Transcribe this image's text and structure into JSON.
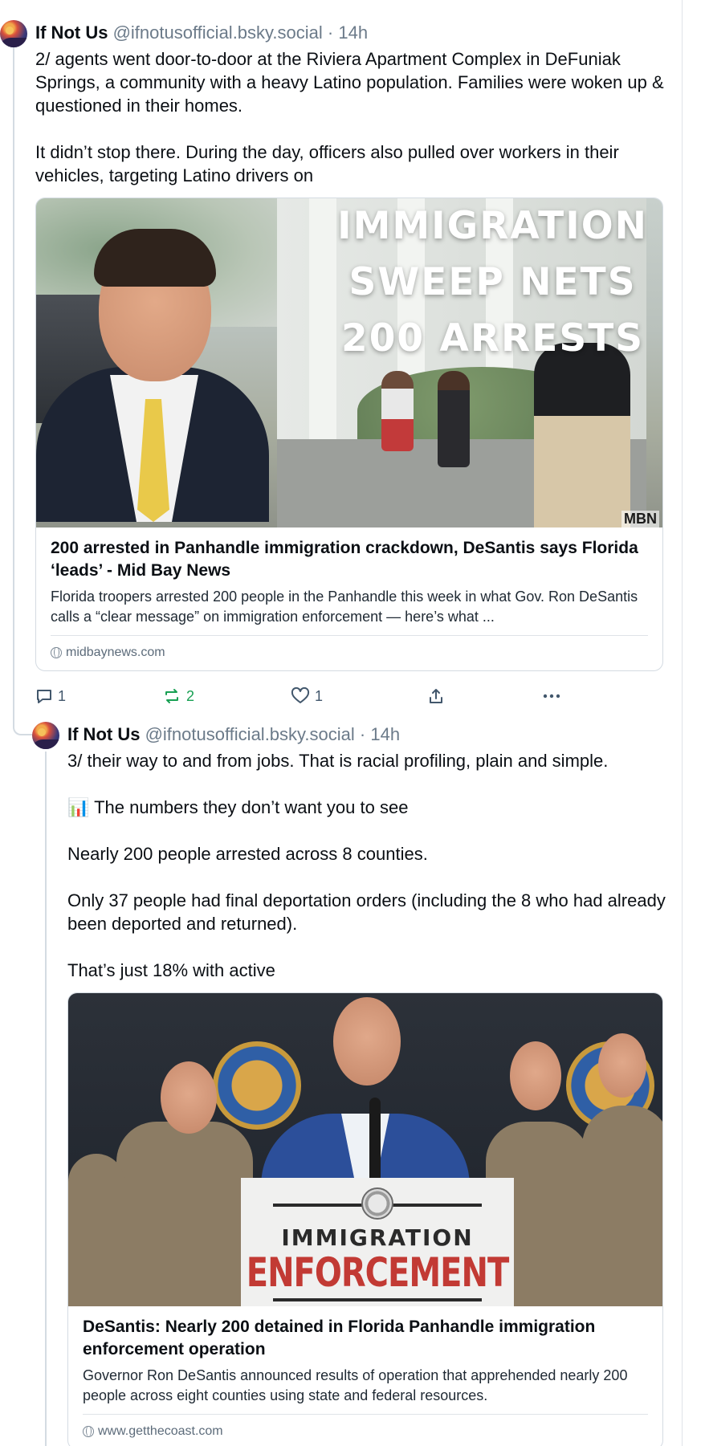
{
  "post1": {
    "author_name": "If Not Us",
    "handle": "@ifnotusofficial.bsky.social",
    "separator": "·",
    "time": "14h",
    "text": "2/ agents went door-to-door at the Riviera Apartment Complex in DeFuniak Springs, a community with a heavy Latino population. Families were woken up & questioned in their homes.\n\nIt didn’t stop there. During the day, officers also pulled over workers in their vehicles, targeting Latino drivers on",
    "card": {
      "image_text": [
        "IMMIGRATION",
        "SWEEP NETS",
        "200 ARRESTS"
      ],
      "image_logo": "MBN",
      "title": "200 arrested in Panhandle immigration crackdown, DeSantis says Florida ‘leads’ - Mid Bay News",
      "description": "Florida troopers arrested 200 people in the Panhandle this week in what Gov. Ron DeSantis calls a “clear message” on immigration enforcement — here’s what ...",
      "domain": "midbaynews.com"
    },
    "actions": {
      "reply_count": "1",
      "repost_count": "2",
      "like_count": "1"
    }
  },
  "post2": {
    "author_name": "If Not Us",
    "handle": "@ifnotusofficial.bsky.social",
    "separator": "·",
    "time": "14h",
    "text": "3/ their way to and from jobs. That is racial profiling, plain and simple.\n\n📊 The numbers they don’t want you to see\n\nNearly 200 people arrested across 8 counties.\n\nOnly 37 people had final deportation orders (including the 8 who had already been deported and returned).\n\nThat’s just 18% with active",
    "card": {
      "podium_line1": "IMMIGRATION",
      "podium_line2": "ENFORCEMENT",
      "title": "DeSantis: Nearly 200 detained in Florida Panhandle immigration enforcement operation",
      "description": "Governor Ron DeSantis announced results of operation that apprehended nearly 200 people across eight counties using state and federal resources.",
      "domain": "www.getthecoast.com"
    }
  },
  "colors": {
    "accent_blue": "#1083fe",
    "repost_green": "#18a053",
    "muted_text": "#6b7a89",
    "border": "#d4dbe2"
  }
}
